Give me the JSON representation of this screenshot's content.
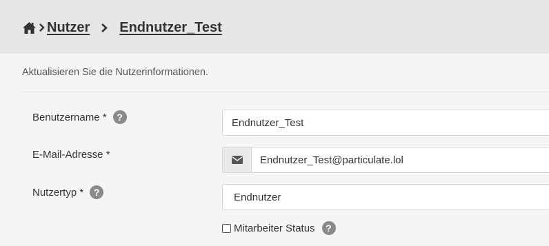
{
  "breadcrumb": {
    "home_icon": "home-icon",
    "items": [
      {
        "label": "Nutzer"
      },
      {
        "label": "Endnutzer_Test"
      }
    ]
  },
  "intro_text": "Aktualisieren Sie die Nutzerinformationen.",
  "form": {
    "username": {
      "label": "Benutzername *",
      "value": "Endnutzer_Test",
      "help_icon": "question-circle-icon"
    },
    "email": {
      "label": "E-Mail-Adresse *",
      "value": "Endnutzer_Test@particulate.lol",
      "addon_icon": "envelope-icon"
    },
    "user_type": {
      "label": "Nutzertyp *",
      "value": "Endnutzer",
      "help_icon": "question-circle-icon"
    },
    "staff_status": {
      "label": "Mitarbeiter Status",
      "checked": false,
      "help_icon": "question-circle-icon"
    }
  },
  "colors": {
    "header_bg": "#e6e6e6",
    "page_bg": "#f5f5f5",
    "help_icon": "#8a8a8a"
  }
}
